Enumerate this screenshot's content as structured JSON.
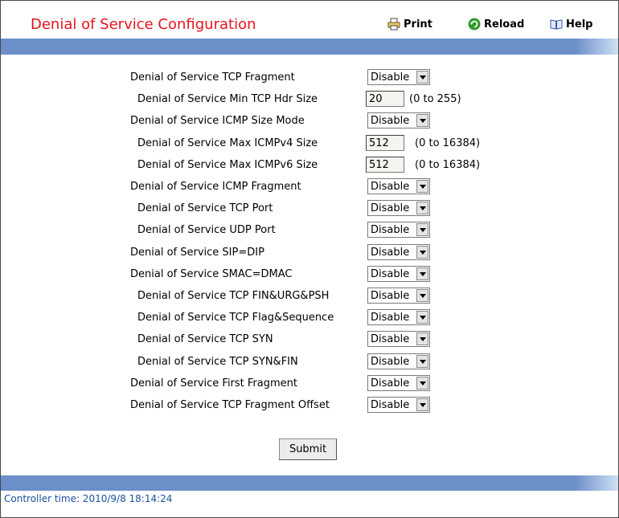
{
  "header": {
    "title": "Denial of Service Configuration",
    "print_label": "Print",
    "reload_label": "Reload",
    "help_label": "Help"
  },
  "rows": [
    {
      "label": "Denial of Service TCP Fragment",
      "type": "select",
      "value": "Disable"
    },
    {
      "label": "Denial of Service Min TCP Hdr Size",
      "type": "input",
      "value": "20",
      "hint": "(0 to 255)"
    },
    {
      "label": "Denial of Service ICMP Size Mode",
      "type": "select",
      "value": "Disable"
    },
    {
      "label": "Denial of Service Max ICMPv4 Size",
      "type": "input",
      "value": "512",
      "hint": "(0 to 16384)"
    },
    {
      "label": "Denial of Service Max ICMPv6 Size",
      "type": "input",
      "value": "512",
      "hint": "(0 to 16384)"
    },
    {
      "label": "Denial of Service ICMP Fragment",
      "type": "select",
      "value": "Disable"
    },
    {
      "label": "Denial of Service TCP Port",
      "type": "select",
      "value": "Disable"
    },
    {
      "label": "Denial of Service UDP Port",
      "type": "select",
      "value": "Disable"
    },
    {
      "label": "Denial of Service SIP=DIP",
      "type": "select",
      "value": "Disable"
    },
    {
      "label": "Denial of Service SMAC=DMAC",
      "type": "select",
      "value": "Disable"
    },
    {
      "label": "Denial of Service TCP FIN&URG&PSH",
      "type": "select",
      "value": "Disable"
    },
    {
      "label": "Denial of Service TCP Flag&Sequence",
      "type": "select",
      "value": "Disable"
    },
    {
      "label": "Denial of Service TCP SYN",
      "type": "select",
      "value": "Disable"
    },
    {
      "label": "Denial of Service TCP SYN&FIN",
      "type": "select",
      "value": "Disable"
    },
    {
      "label": "Denial of Service First Fragment",
      "type": "select",
      "value": "Disable"
    },
    {
      "label": "Denial of Service TCP Fragment Offset",
      "type": "select",
      "value": "Disable"
    }
  ],
  "submit_label": "Submit",
  "footer": {
    "controller_time": "Controller time: 2010/9/8 18:14:24"
  },
  "colors": {
    "title": "#e8141e",
    "bar": "#6b8fc9",
    "footer_text": "#1c4fa0"
  }
}
